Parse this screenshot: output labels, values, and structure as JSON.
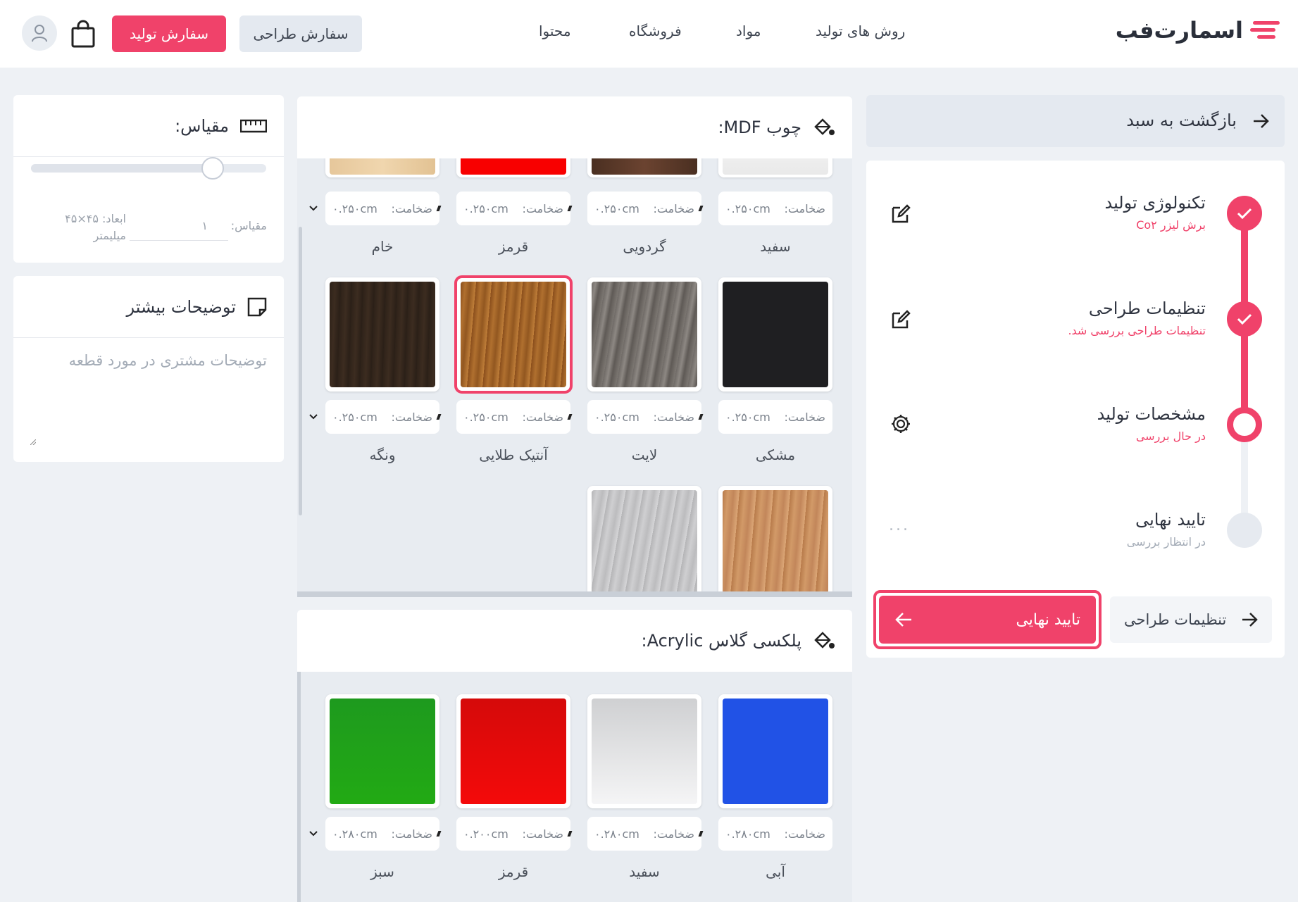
{
  "header": {
    "logo_text": "اسمارت‌فب",
    "nav": [
      "روش های تولید",
      "مواد",
      "فروشگاه",
      "محتوا"
    ],
    "design_order_label": "سفارش طراحی",
    "production_order_label": "سفارش تولید"
  },
  "scale_card": {
    "title": "مقیاس:",
    "scale_label": "مقیاس:",
    "scale_value": "۱",
    "dims_label": "ابعاد: ۴۵×۴۵",
    "unit": "میلیمتر",
    "slider_level": 0.8
  },
  "notes_card": {
    "title": "توضیحات بیشتر",
    "placeholder": "توضیحات مشتری در مورد قطعه"
  },
  "mdf": {
    "title": "چوب MDF:",
    "thickness_label": "ضخامت:",
    "row1": [
      {
        "name": "سفید",
        "thickness": "۰.۲۵۰cm"
      },
      {
        "name": "گردویی",
        "thickness": "۰.۲۵۰cm"
      },
      {
        "name": "قرمز",
        "thickness": "۰.۲۵۰cm"
      },
      {
        "name": "خام",
        "thickness": "۰.۲۵۰cm"
      }
    ],
    "row2": [
      {
        "name": "مشکی",
        "thickness": "۰.۲۵۰cm"
      },
      {
        "name": "لایت",
        "thickness": "۰.۲۵۰cm"
      },
      {
        "name": "آنتیک طلایی",
        "thickness": "۰.۲۵۰cm"
      },
      {
        "name": "ونگه",
        "thickness": "۰.۲۵۰cm"
      }
    ]
  },
  "acrylic": {
    "title": "پلکسی گلاس Acrylic:",
    "thickness_label": "ضخامت:",
    "items": [
      {
        "name": "آبی",
        "thickness": "۰.۲۸۰cm"
      },
      {
        "name": "سفید",
        "thickness": "۰.۲۸۰cm"
      },
      {
        "name": "قرمز",
        "thickness": "۰.۲۰۰cm"
      },
      {
        "name": "سبز",
        "thickness": "۰.۲۸۰cm"
      }
    ]
  },
  "sidebar": {
    "back_label": "بازگشت به سبد",
    "steps": [
      {
        "title": "تکنولوژی تولید",
        "sub": "برش لیزر Co۲"
      },
      {
        "title": "تنظیمات طراحی",
        "sub": "تنظیمات طراحی بررسی شد."
      },
      {
        "title": "مشخصات تولید",
        "sub": "در حال بررسی"
      },
      {
        "title": "تایید نهایی",
        "sub": "در انتظار بررسی"
      }
    ],
    "final_label": "تایید نهایی",
    "settings_label": "تنظیمات طراحی",
    "ellipsis": "..."
  },
  "colors": {
    "accent": "#f0426a",
    "muted": "#e4e9f0"
  }
}
